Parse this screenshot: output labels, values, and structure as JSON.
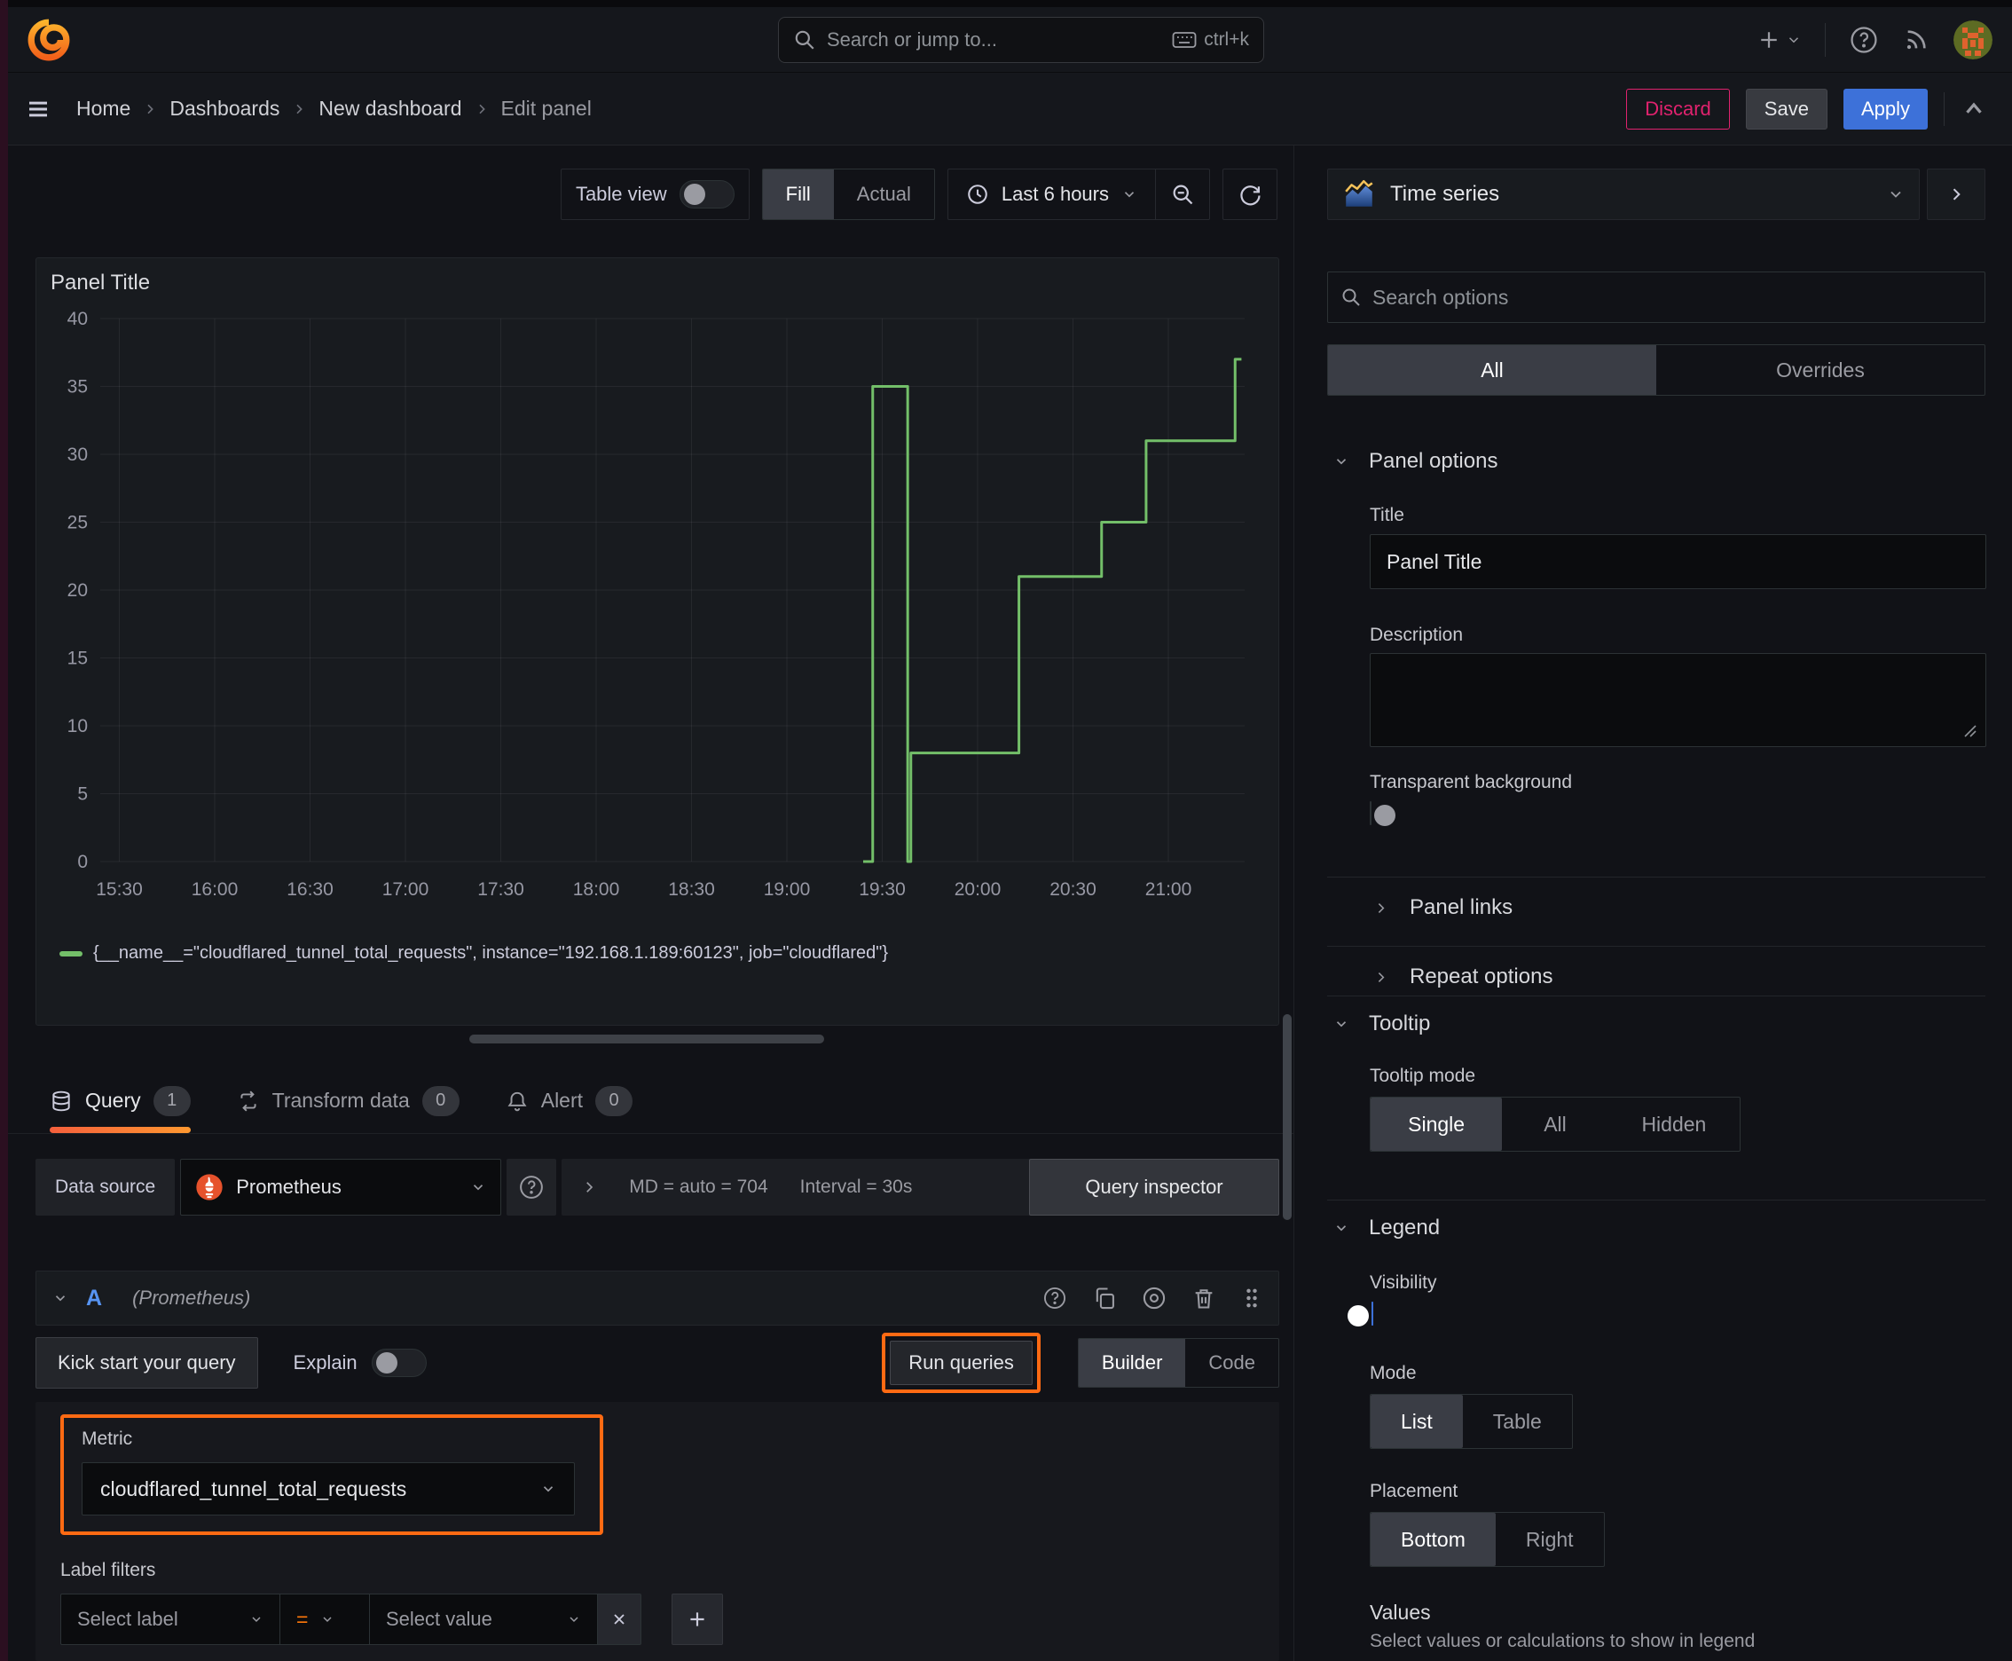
{
  "topbar": {
    "search": {
      "placeholder": "Search or jump to...",
      "shortcut": "ctrl+k"
    }
  },
  "breadcrumb": {
    "items": [
      {
        "label": "Home"
      },
      {
        "label": "Dashboards"
      },
      {
        "label": "New dashboard"
      },
      {
        "label": "Edit panel"
      }
    ]
  },
  "actions": {
    "discard": "Discard",
    "save": "Save",
    "apply": "Apply"
  },
  "viz_toolbar": {
    "table_view": "Table view",
    "fill": "Fill",
    "actual": "Actual",
    "time_range": "Last 6 hours"
  },
  "panel": {
    "title": "Panel Title"
  },
  "chart_data": {
    "type": "line",
    "subtype": "step-after",
    "title": "Panel Title",
    "xlabel": "",
    "ylabel": "",
    "x_domain": [
      "15:24",
      "21:24"
    ],
    "x_ticks": [
      "15:30",
      "16:00",
      "16:30",
      "17:00",
      "17:30",
      "18:00",
      "18:30",
      "19:00",
      "19:30",
      "20:00",
      "20:30",
      "21:00"
    ],
    "ylim": [
      0,
      40
    ],
    "y_ticks": [
      0,
      5,
      10,
      15,
      20,
      25,
      30,
      35,
      40
    ],
    "grid": true,
    "legend_position": "bottom",
    "series": [
      {
        "name": "{__name__=\"cloudflared_tunnel_total_requests\", instance=\"192.168.1.189:60123\", job=\"cloudflared\"}",
        "color": "#73bf69",
        "points": [
          {
            "x": "19:24",
            "y": 0
          },
          {
            "x": "19:27",
            "y": 35
          },
          {
            "x": "19:38",
            "y": 0
          },
          {
            "x": "19:39",
            "y": 8
          },
          {
            "x": "20:13",
            "y": 21
          },
          {
            "x": "20:39",
            "y": 25
          },
          {
            "x": "20:53",
            "y": 31
          },
          {
            "x": "21:21",
            "y": 37
          },
          {
            "x": "21:23",
            "y": 37
          }
        ]
      }
    ]
  },
  "editor": {
    "tabs": [
      {
        "label": "Query",
        "count": "1"
      },
      {
        "label": "Transform data",
        "count": "0"
      },
      {
        "label": "Alert",
        "count": "0"
      }
    ],
    "datasource": {
      "label": "Data source",
      "name": "Prometheus",
      "stat_md": "MD = auto = 704",
      "stat_interval": "Interval = 30s",
      "inspector": "Query inspector"
    },
    "query": {
      "ref": "A",
      "ds_hint": "(Prometheus)",
      "kick_start": "Kick start your query",
      "explain": "Explain",
      "run_queries": "Run queries",
      "builder": "Builder",
      "code": "Code",
      "metric_label": "Metric",
      "metric_value": "cloudflared_tunnel_total_requests",
      "label_filters_label": "Label filters",
      "select_label": "Select label",
      "operator": "=",
      "select_value": "Select value"
    }
  },
  "options": {
    "viz_name": "Time series",
    "search_placeholder": "Search options",
    "tabs": {
      "all": "All",
      "overrides": "Overrides"
    },
    "panel_options": {
      "title": "Panel options",
      "title_label": "Title",
      "title_value": "Panel Title",
      "description_label": "Description",
      "transparent_label": "Transparent background",
      "panel_links": "Panel links",
      "repeat_options": "Repeat options"
    },
    "tooltip": {
      "title": "Tooltip",
      "mode_label": "Tooltip mode",
      "modes": [
        "Single",
        "All",
        "Hidden"
      ]
    },
    "legend": {
      "title": "Legend",
      "visibility_label": "Visibility",
      "mode_label": "Mode",
      "modes": [
        "List",
        "Table"
      ],
      "placement_label": "Placement",
      "placements": [
        "Bottom",
        "Right"
      ],
      "values_label": "Values",
      "values_hint": "Select values or calculations to show in legend"
    }
  },
  "colors": {
    "series_green": "#73bf69",
    "highlight_orange": "#ff6a13",
    "apply_blue": "#3d71d9",
    "discard_pink": "#e0226e",
    "tab_active_orange": "#ff780a"
  }
}
